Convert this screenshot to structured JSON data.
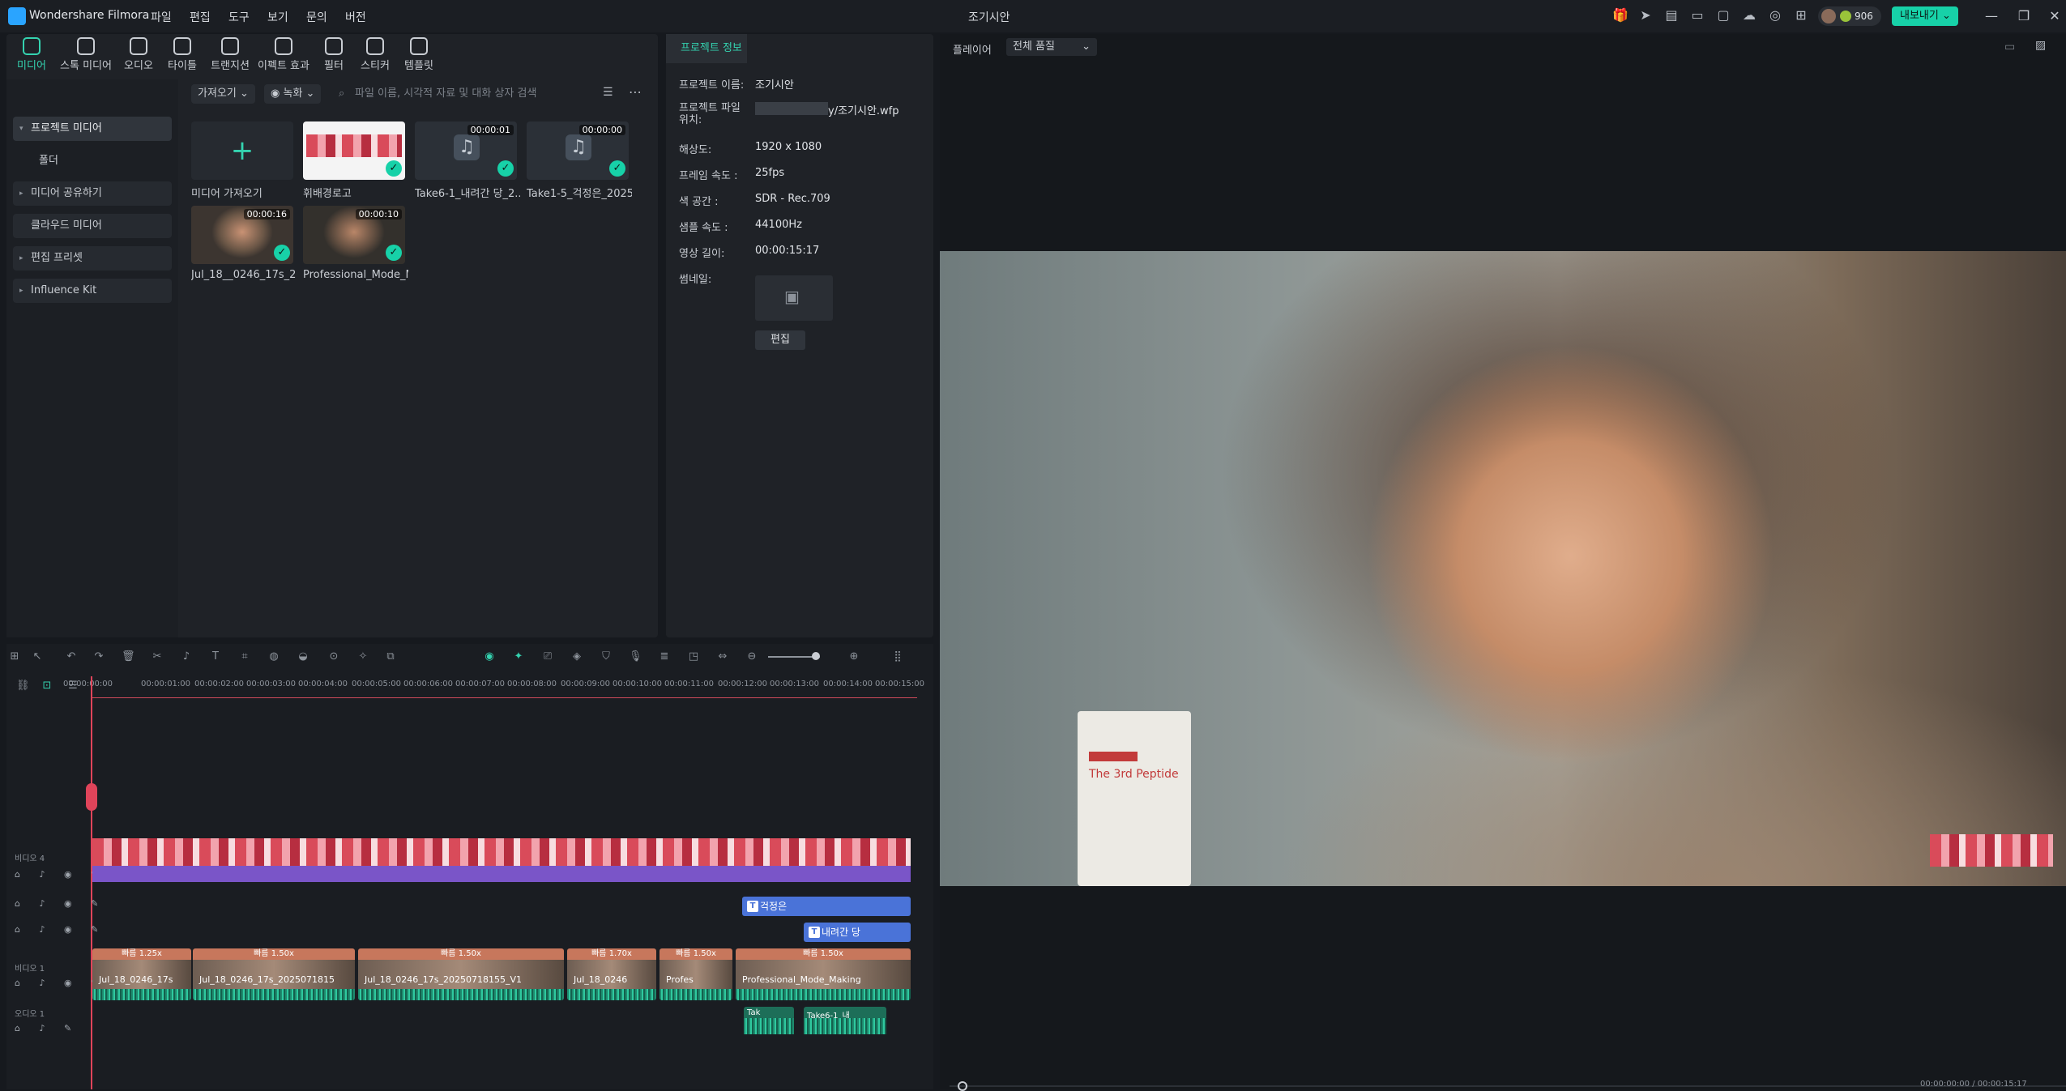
{
  "app": {
    "name": "Wondershare Filmora",
    "project_title": "조기시안"
  },
  "menu": [
    "파일",
    "편집",
    "도구",
    "보기",
    "문의",
    "버전"
  ],
  "account": {
    "credits": "906"
  },
  "export_label": "내보내기",
  "tool_tabs": [
    {
      "label": "미디어",
      "icon": "media-icon"
    },
    {
      "label": "스톡 미디어",
      "icon": "stock-media-icon"
    },
    {
      "label": "오디오",
      "icon": "music-note-icon"
    },
    {
      "label": "타이틀",
      "icon": "title-t-icon"
    },
    {
      "label": "트랜지션",
      "icon": "transition-icon"
    },
    {
      "label": "이펙트 효과",
      "icon": "effects-icon"
    },
    {
      "label": "필터",
      "icon": "filter-icon"
    },
    {
      "label": "스티커",
      "icon": "sticker-icon"
    },
    {
      "label": "템플릿",
      "icon": "template-icon"
    }
  ],
  "media_sidebar": [
    {
      "label": "프로젝트 미디어",
      "expanded": true
    },
    {
      "label": "폴더"
    },
    {
      "label": "미디어 공유하기"
    },
    {
      "label": "클라우드 미디어"
    },
    {
      "label": "편집 프리셋"
    },
    {
      "label": "Influence Kit"
    }
  ],
  "media_toolbar": {
    "import_label": "가져오기",
    "record_label": "녹화",
    "search_placeholder": "파일 이름, 시각적 자료 및 대화 상자 검색"
  },
  "media_items": [
    {
      "label": "미디어 가져오기",
      "type": "import"
    },
    {
      "label": "휘배경로고",
      "type": "image"
    },
    {
      "label": "Take6-1_내려간 당_2...",
      "type": "audio",
      "duration": "00:00:01"
    },
    {
      "label": "Take1-5_걱정은_2025...",
      "type": "audio",
      "duration": "00:00:00"
    },
    {
      "label": "Jul_18__0246_17s_20...",
      "type": "video",
      "duration": "00:00:16"
    },
    {
      "label": "Professional_Mode_M...",
      "type": "video",
      "duration": "00:00:10"
    }
  ],
  "project_info": {
    "tab_label": "프로젝트 정보",
    "rows": [
      {
        "key": "프로젝트 이름:",
        "value": "조기시안"
      },
      {
        "key": "프로젝트 파일 위치:",
        "value": "y/조기시안.wfp"
      },
      {
        "key": "해상도:",
        "value": "1920 x 1080"
      },
      {
        "key": "프레임 속도 :",
        "value": "25fps"
      },
      {
        "key": "색 공간 :",
        "value": "SDR - Rec.709"
      },
      {
        "key": "샘플 속도 :",
        "value": "44100Hz"
      },
      {
        "key": "영상 길이:",
        "value": "00:00:15:17"
      }
    ],
    "thumbnail_label": "썸네일:",
    "edit_label": "편집"
  },
  "player": {
    "label": "플레이어",
    "quality": "전체 품질",
    "product_text": "The 3rd Peptide",
    "current_time": "00:00:00:00",
    "total_time": "00:00:15:17"
  },
  "timeline": {
    "ruler": [
      "00:00:00:00",
      "00:00:01:00",
      "00:00:02:00",
      "00:00:03:00",
      "00:00:04:00",
      "00:00:05:00",
      "00:00:06:00",
      "00:00:07:00",
      "00:00:08:00",
      "00:00:09:00",
      "00:00:10:00",
      "00:00:11:00",
      "00:00:12:00",
      "00:00:13:00",
      "00:00:14:00",
      "00:00:15:00"
    ],
    "tracks": {
      "video4": "비디오 4",
      "video1": "비디오 1",
      "audio1": "오디오 1"
    },
    "title_clips": [
      "걱정은",
      "내려간 당"
    ],
    "video_clips": [
      {
        "speed": "빠름 1.25x",
        "name": "Jul_18_0246_17s"
      },
      {
        "speed": "빠름 1.50x",
        "name": "Jul_18_0246_17s_2025071815"
      },
      {
        "speed": "빠름 1.50x",
        "name": "Jul_18_0246_17s_20250718155_V1"
      },
      {
        "speed": "빠름 1.70x",
        "name": "Jul_18_0246"
      },
      {
        "speed": "빠름 1.50x",
        "name": "Profes"
      },
      {
        "speed": "빠름 1.50x",
        "name": "Professional_Mode_Making"
      }
    ],
    "audio_clips": [
      "Tak",
      "Take6-1_내"
    ]
  },
  "colors": {
    "accent": "#17d1a8",
    "title_clip": "#4a73d8",
    "video_clip_header": "#c7775c",
    "playhead": "#e0445a"
  }
}
